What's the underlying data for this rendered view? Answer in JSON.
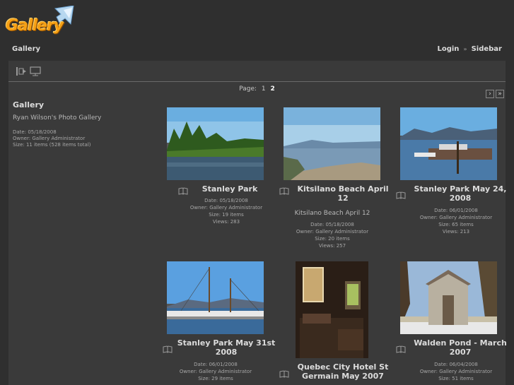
{
  "logo": {
    "text": "Gallery"
  },
  "nav": {
    "breadcrumb": "Gallery",
    "login": "Login",
    "separator": "»",
    "sidebar": "Sidebar"
  },
  "toolbar": {
    "icons": [
      "exit-icon",
      "slideshow-icon"
    ]
  },
  "pager": {
    "label": "Page:",
    "pages": [
      "1",
      "2"
    ],
    "current": "2",
    "next_icon": "next-arrow-icon",
    "last_icon": "last-arrow-icon"
  },
  "album_info": {
    "title": "Gallery",
    "description": "Ryan Wilson's Photo Gallery",
    "date": "Date: 05/18/2008",
    "owner": "Owner: Gallery Administrator",
    "size": "Size: 11 items (528 items total)"
  },
  "items": [
    {
      "title": "Stanley Park",
      "summary": "",
      "date": "Date: 05/18/2008",
      "owner": "Owner: Gallery Administrator",
      "size": "Size: 19 items",
      "views": "Views: 283"
    },
    {
      "title": "Kitsilano Beach April 12",
      "summary": "Kitsilano Beach April 12",
      "date": "Date: 05/18/2008",
      "owner": "Owner: Gallery Administrator",
      "size": "Size: 20 items",
      "views": "Views: 257"
    },
    {
      "title": "Stanley Park May 24, 2008",
      "summary": "",
      "date": "Date: 06/01/2008",
      "owner": "Owner: Gallery Administrator",
      "size": "Size: 65 items",
      "views": "Views: 213"
    },
    {
      "title": "Stanley Park May 31st 2008",
      "summary": "",
      "date": "Date: 06/01/2008",
      "owner": "Owner: Gallery Administrator",
      "size": "Size: 29 items",
      "views": ""
    },
    {
      "title": "Quebec City Hotel St Germain May 2007",
      "summary": "",
      "date": "",
      "owner": "",
      "size": "",
      "views": ""
    },
    {
      "title": "Walden Pond - March 2007",
      "summary": "",
      "date": "Date: 06/04/2008",
      "owner": "Owner: Gallery Administrator",
      "size": "Size: 51 items",
      "views": ""
    }
  ]
}
